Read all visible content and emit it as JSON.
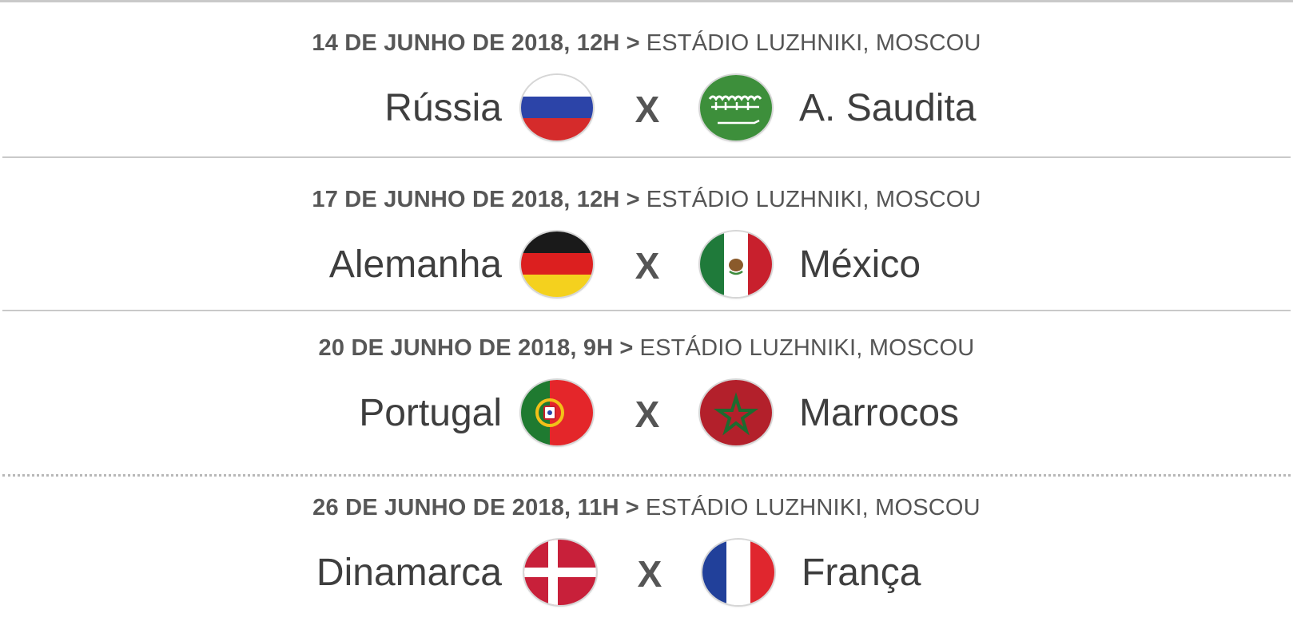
{
  "matches": [
    {
      "date": "14 DE JUNHO DE 2018, 12H",
      "separator": ">",
      "venue": "ESTÁDIO LUZHNIKI, MOSCOU",
      "home": "Rússia",
      "home_flag": "russia-flag-icon",
      "vs": "X",
      "away": "A. Saudita",
      "away_flag": "saudi-arabia-flag-icon"
    },
    {
      "date": "17 DE JUNHO DE 2018, 12H",
      "separator": ">",
      "venue": "ESTÁDIO LUZHNIKI, MOSCOU",
      "home": "Alemanha",
      "home_flag": "germany-flag-icon",
      "vs": "X",
      "away": "México",
      "away_flag": "mexico-flag-icon"
    },
    {
      "date": "20 DE JUNHO DE 2018, 9H",
      "separator": ">",
      "venue": "ESTÁDIO LUZHNIKI, MOSCOU",
      "home": "Portugal",
      "home_flag": "portugal-flag-icon",
      "vs": "X",
      "away": "Marrocos",
      "away_flag": "morocco-flag-icon"
    },
    {
      "date": "26 DE JUNHO DE 2018, 11H",
      "separator": ">",
      "venue": "ESTÁDIO LUZHNIKI, MOSCOU",
      "home": "Dinamarca",
      "home_flag": "denmark-flag-icon",
      "vs": "X",
      "away": "França",
      "away_flag": "france-flag-icon"
    }
  ]
}
